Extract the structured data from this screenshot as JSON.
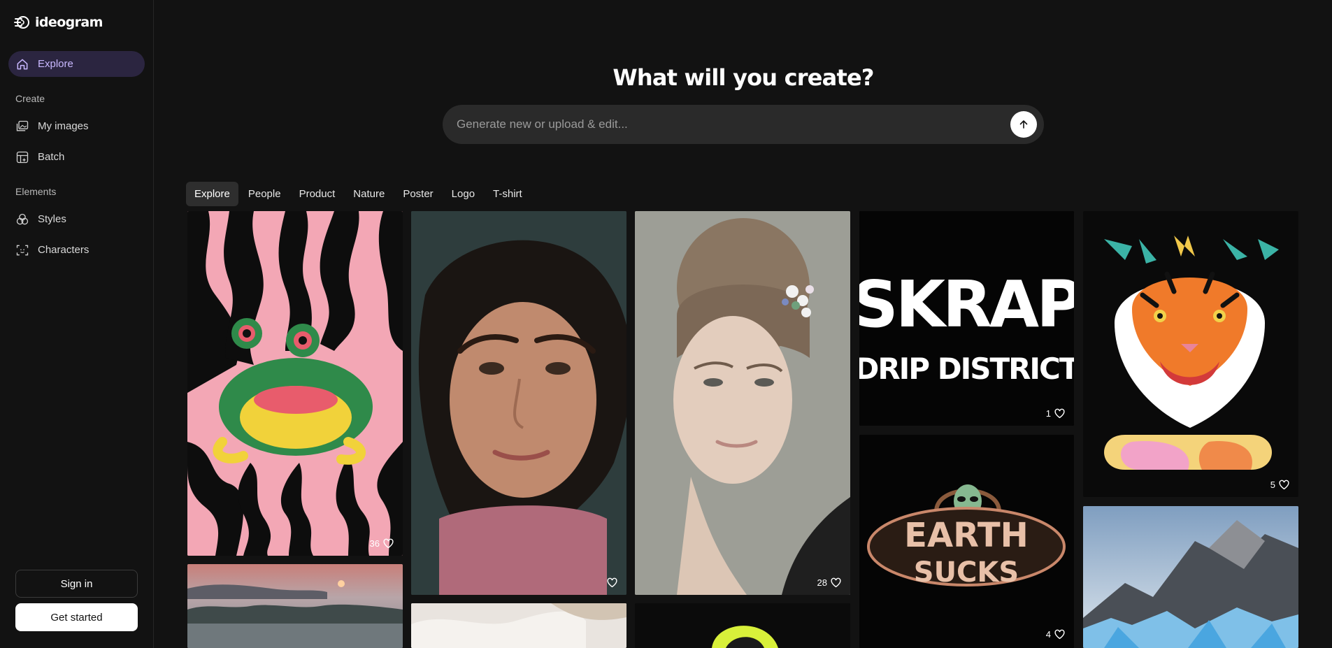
{
  "brand": {
    "name": "ideogram"
  },
  "sidebar": {
    "explore": "Explore",
    "create_label": "Create",
    "my_images": "My images",
    "batch": "Batch",
    "elements_label": "Elements",
    "styles": "Styles",
    "characters": "Characters",
    "sign_in": "Sign in",
    "get_started": "Get started"
  },
  "hero": {
    "title": "What will you create?",
    "placeholder": "Generate new or upload & edit..."
  },
  "tabs": [
    "Explore",
    "People",
    "Product",
    "Nature",
    "Poster",
    "Logo",
    "T-shirt"
  ],
  "gallery": [
    {
      "subject": "frog-poster",
      "likes": "36"
    },
    {
      "subject": "woman-portrait-curly",
      "likes": ""
    },
    {
      "subject": "woman-portrait-bun",
      "likes": "28"
    },
    {
      "subject": "skrap-logo",
      "likes": "1",
      "text": [
        "SKRAP",
        "DRIP DISTRICT"
      ]
    },
    {
      "subject": "tiger-tshirt",
      "likes": "5"
    },
    {
      "subject": "misty-landscape",
      "likes": ""
    },
    {
      "subject": "white-fabric",
      "likes": ""
    },
    {
      "subject": "yellow-graphic",
      "likes": ""
    },
    {
      "subject": "alien-earth-logo",
      "likes": "4",
      "text": [
        "EARTH",
        "SUCKS"
      ]
    },
    {
      "subject": "mountain-ice",
      "likes": ""
    }
  ],
  "colors": {
    "accent": "#c9b8ff",
    "active_bg": "#2b2540",
    "bg": "#121212"
  }
}
